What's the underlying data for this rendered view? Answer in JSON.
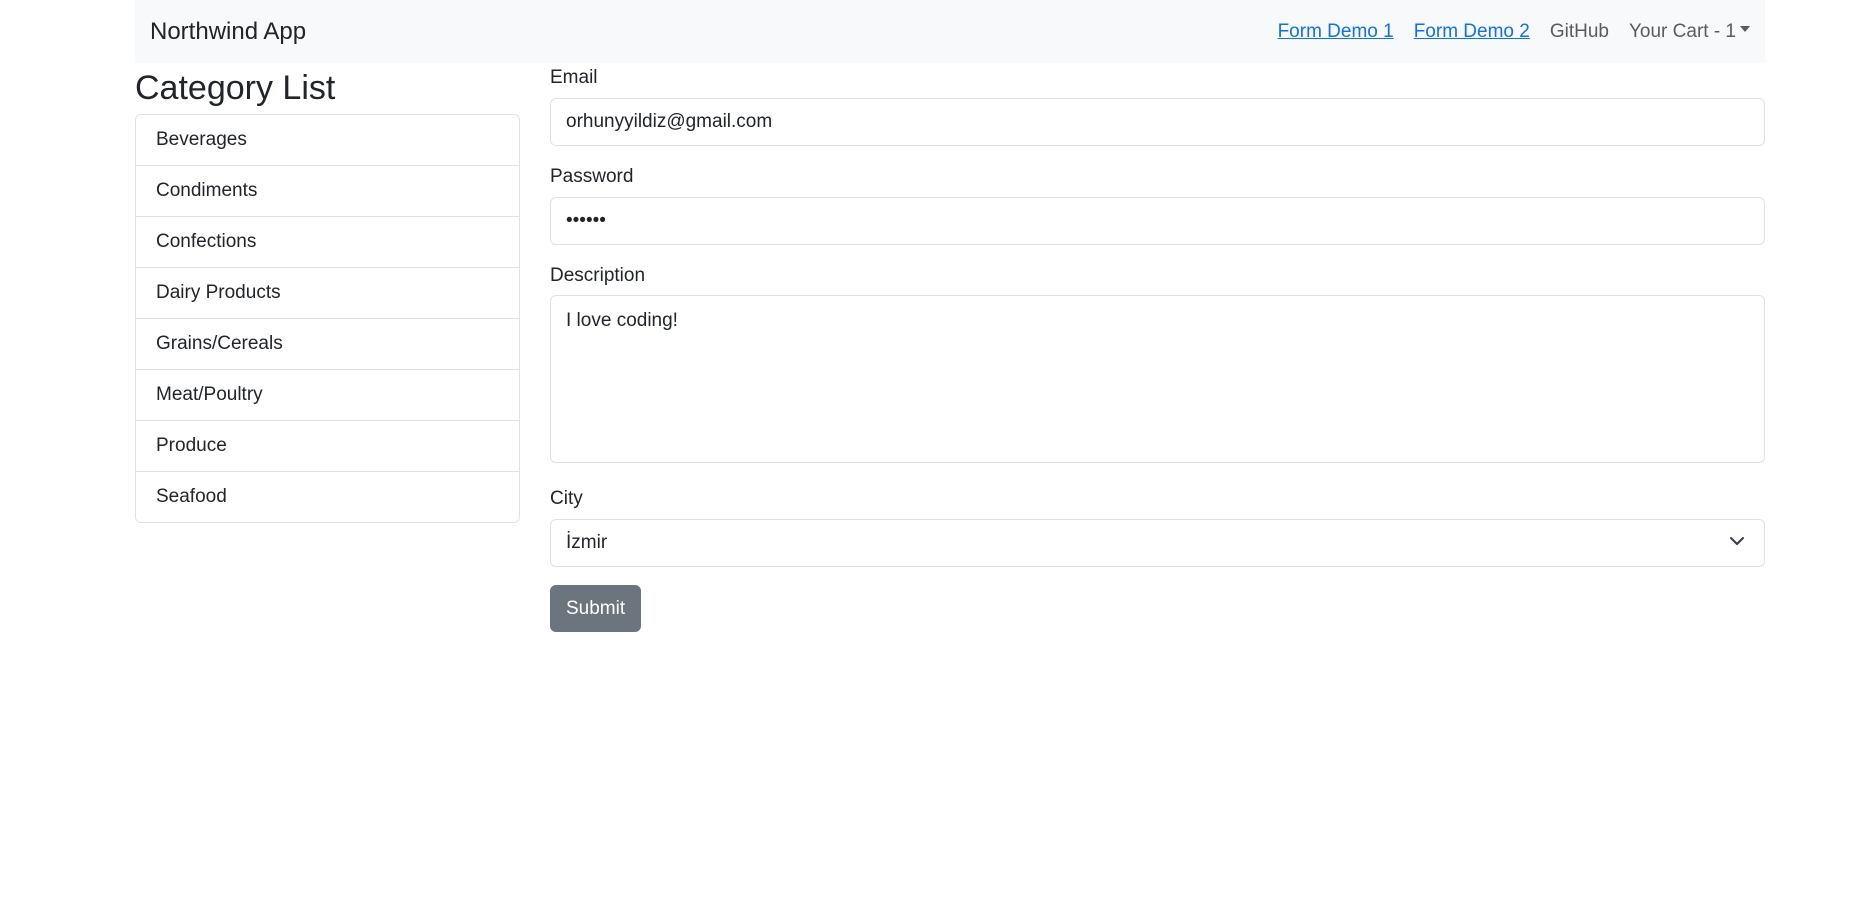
{
  "navbar": {
    "brand": "Northwind App",
    "links": [
      {
        "label": "Form Demo 1"
      },
      {
        "label": "Form Demo 2"
      },
      {
        "label": "GitHub"
      },
      {
        "label": "Your Cart - 1"
      }
    ]
  },
  "sidebar": {
    "title": "Category List",
    "items": [
      {
        "label": "Beverages"
      },
      {
        "label": "Condiments"
      },
      {
        "label": "Confections"
      },
      {
        "label": "Dairy Products"
      },
      {
        "label": "Grains/Cereals"
      },
      {
        "label": "Meat/Poultry"
      },
      {
        "label": "Produce"
      },
      {
        "label": "Seafood"
      }
    ]
  },
  "form": {
    "email": {
      "label": "Email",
      "value": "orhunyyildiz@gmail.com"
    },
    "password": {
      "label": "Password",
      "value": "••••••"
    },
    "description": {
      "label": "Description",
      "value": "I love coding!"
    },
    "city": {
      "label": "City",
      "value": "İzmir"
    },
    "submit_label": "Submit"
  },
  "icons": {
    "cart_dropdown": "caret-down-icon",
    "city_select": "chevron-down-icon"
  },
  "colors": {
    "navbar_bg": "#f8f9fa",
    "link": "#0d6efd",
    "button": "#6c757d"
  }
}
